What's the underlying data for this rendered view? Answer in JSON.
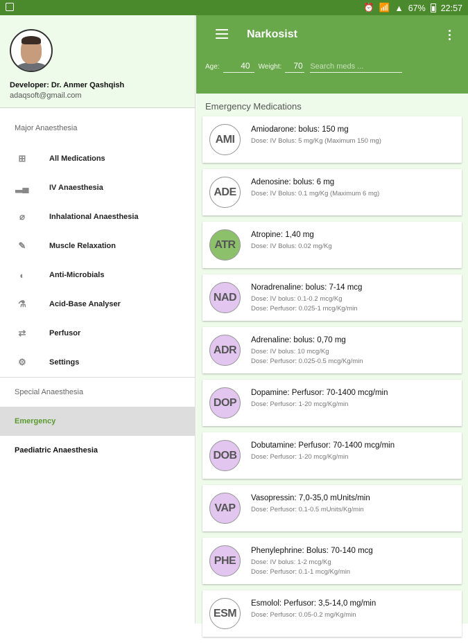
{
  "status_bar": {
    "battery": "67%",
    "time": "22:57"
  },
  "drawer": {
    "developer": "Developer: Dr. Anmer Qashqish",
    "email": "adaqsoft@gmail.com",
    "major_section": "Major Anaesthesia",
    "major_items": [
      {
        "label": "All Medications",
        "icon": "plus-box-icon"
      },
      {
        "label": "IV Anaesthesia",
        "icon": "bars-icon"
      },
      {
        "label": "Inhalational Anaesthesia",
        "icon": "capsule-icon"
      },
      {
        "label": "Muscle Relaxation",
        "icon": "syringe-icon"
      },
      {
        "label": "Anti-Microbials",
        "icon": "pill-icon"
      },
      {
        "label": "Acid-Base Analyser",
        "icon": "flask-icon"
      },
      {
        "label": "Perfusor",
        "icon": "pump-icon"
      },
      {
        "label": "Settings",
        "icon": "gear-icon"
      }
    ],
    "special_item": "Special Anaesthesia",
    "emergency_item": "Emergency",
    "paediatric_item": "Paediatric Anaesthesia"
  },
  "appbar": {
    "title": "Narkosist",
    "age_label": "Age:",
    "age_value": "40",
    "weight_label": "Weight:",
    "weight_value": "70",
    "search_placeholder": "Search meds ..."
  },
  "list_title": "Emergency Medications",
  "medications": [
    {
      "abbr": "AMI",
      "title": "Amiodarone: bolus: 150 mg",
      "lines": [
        "Dose: IV Bolus: 5 mg/Kg (Maximum 150 mg)"
      ],
      "badge_color": "#ffffff"
    },
    {
      "abbr": "ADE",
      "title": "Adenosine: bolus: 6 mg",
      "lines": [
        "Dose: IV Bolus: 0.1 mg/Kg (Maximum 6 mg)"
      ],
      "badge_color": "#ffffff"
    },
    {
      "abbr": "ATR",
      "title": "Atropine: 1,40 mg",
      "lines": [
        "Dose: IV Bolus: 0.02 mg/Kg"
      ],
      "badge_color": "#8dc06b"
    },
    {
      "abbr": "NAD",
      "title": "Noradrenaline: bolus: 7-14 mcg",
      "lines": [
        "Dose: IV bolus: 0.1-0.2 mcg/Kg",
        "Dose: Perfusor: 0.025-1 mcg/Kg/min"
      ],
      "badge_color": "#e3c6f0"
    },
    {
      "abbr": "ADR",
      "title": "Adrenaline: bolus: 0,70 mg",
      "lines": [
        "Dose: IV bolus: 10 mcg/Kg",
        "Dose: Perfusor: 0.025-0.5 mcg/Kg/min"
      ],
      "badge_color": "#e3c6f0"
    },
    {
      "abbr": "DOP",
      "title": "Dopamine: Perfusor: 70-1400 mcg/min",
      "lines": [
        "Dose: Perfusor: 1-20 mcg/Kg/min"
      ],
      "badge_color": "#e3c6f0"
    },
    {
      "abbr": "DOB",
      "title": "Dobutamine: Perfusor: 70-1400 mcg/min",
      "lines": [
        "Dose: Perfusor: 1-20 mcg/Kg/min"
      ],
      "badge_color": "#e3c6f0"
    },
    {
      "abbr": "VAP",
      "title": "Vasopressin: 7,0-35,0 mUnits/min",
      "lines": [
        "Dose: Perfusor: 0.1-0.5 mUnits/Kg/min"
      ],
      "badge_color": "#e3c6f0"
    },
    {
      "abbr": "PHE",
      "title": "Phenylephrine: Bolus: 70-140 mcg",
      "lines": [
        "Dose: IV bolus: 1-2 mcg/Kg",
        "Dose: Perfusor: 0.1-1 mcg/Kg/min"
      ],
      "badge_color": "#e3c6f0"
    },
    {
      "abbr": "ESM",
      "title": "Esmolol: Perfusor: 3,5-14,0 mg/min",
      "lines": [
        "Dose: Perfusor: 0.05-0.2 mg/Kg/min"
      ],
      "badge_color": "#ffffff"
    }
  ]
}
